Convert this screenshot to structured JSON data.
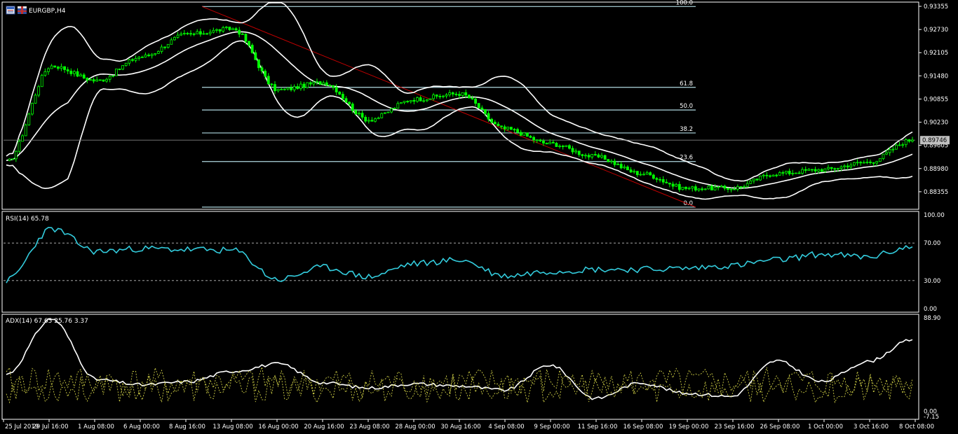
{
  "window": {
    "title": "EURGBP,H4",
    "icon_names": [
      "chart-window-icon",
      "flag-icon"
    ]
  },
  "colors": {
    "background": "#000000",
    "grid_border": "#ffffff",
    "candle": "#00ff00",
    "bollinger": "#ffffff",
    "fibo": "#b0d8e0",
    "trendline": "#c00000",
    "rsi": "#33ccdd",
    "adx_main": "#ffffff",
    "di_plus": "#cccc44",
    "di_minus": "#cccc44"
  },
  "main_panel": {
    "price_axis": [
      "0.93355",
      "0.92730",
      "0.92105",
      "0.91480",
      "0.90855",
      "0.90230",
      "0.89605",
      "0.88980",
      "0.88355"
    ],
    "current_price": "0.89746",
    "fibo_levels": [
      {
        "label": "100.0",
        "price": 0.9335
      },
      {
        "label": "61.8",
        "price": 0.9117
      },
      {
        "label": "50.0",
        "price": 0.9056
      },
      {
        "label": "38.2",
        "price": 0.8994
      },
      {
        "label": "23.6",
        "price": 0.8917
      },
      {
        "label": "0.0",
        "price": 0.8794
      }
    ]
  },
  "rsi_panel": {
    "title": "RSI(14) 65.78",
    "axis": [
      "100.00",
      "70.00",
      "30.00",
      "0.00"
    ]
  },
  "adx_panel": {
    "title": "ADX(14) 67.65 25.76 3.37",
    "axis": [
      "88.90",
      "0.00",
      "-7.15"
    ]
  },
  "time_axis": [
    "25 Jul 2019",
    "29 Jul 16:00",
    "1 Aug 08:00",
    "6 Aug 00:00",
    "8 Aug 16:00",
    "13 Aug 08:00",
    "16 Aug 00:00",
    "20 Aug 16:00",
    "23 Aug 08:00",
    "28 Aug 00:00",
    "30 Aug 16:00",
    "4 Sep 08:00",
    "9 Sep 00:00",
    "11 Sep 16:00",
    "16 Sep 08:00",
    "19 Sep 00:00",
    "23 Sep 16:00",
    "26 Sep 08:00",
    "1 Oct 00:00",
    "3 Oct 16:00",
    "8 Oct 08:00"
  ],
  "chart_data": {
    "type": "line",
    "symbol": "EURGBP",
    "timeframe": "H4",
    "x": [
      "25 Jul 2019",
      "29 Jul 16:00",
      "1 Aug 08:00",
      "6 Aug 00:00",
      "8 Aug 16:00",
      "13 Aug 08:00",
      "16 Aug 00:00",
      "20 Aug 16:00",
      "23 Aug 08:00",
      "28 Aug 00:00",
      "30 Aug 16:00",
      "4 Sep 08:00",
      "9 Sep 00:00",
      "11 Sep 16:00",
      "16 Sep 08:00",
      "19 Sep 00:00",
      "23 Sep 16:00",
      "26 Sep 08:00",
      "1 Oct 00:00",
      "3 Oct 16:00",
      "8 Oct 08:00"
    ],
    "series": [
      {
        "name": "EURGBP",
        "values": [
          0.8915,
          0.9175,
          0.9135,
          0.92,
          0.926,
          0.9275,
          0.911,
          0.913,
          0.903,
          0.9085,
          0.91,
          0.9005,
          0.8965,
          0.893,
          0.8885,
          0.8845,
          0.8845,
          0.8885,
          0.8895,
          0.8915,
          0.8975
        ]
      },
      {
        "name": "RSI(14)",
        "values": [
          30,
          85,
          61,
          64,
          63,
          62,
          31,
          44,
          34,
          48,
          52,
          35,
          40,
          42,
          42,
          43,
          46,
          52,
          58,
          55,
          66
        ]
      },
      {
        "name": "ADX(14)",
        "values": [
          35,
          88,
          30,
          25,
          28,
          38,
          45,
          27,
          22,
          26,
          24,
          20,
          44,
          12,
          27,
          17,
          14,
          48,
          28,
          47,
          68
        ]
      }
    ],
    "rsi_levels": [
      70,
      30
    ],
    "ylim_price": [
      0.879,
      0.9345
    ],
    "ylim_rsi": [
      0,
      100
    ],
    "ylim_adx": [
      -7.15,
      88.9
    ]
  }
}
